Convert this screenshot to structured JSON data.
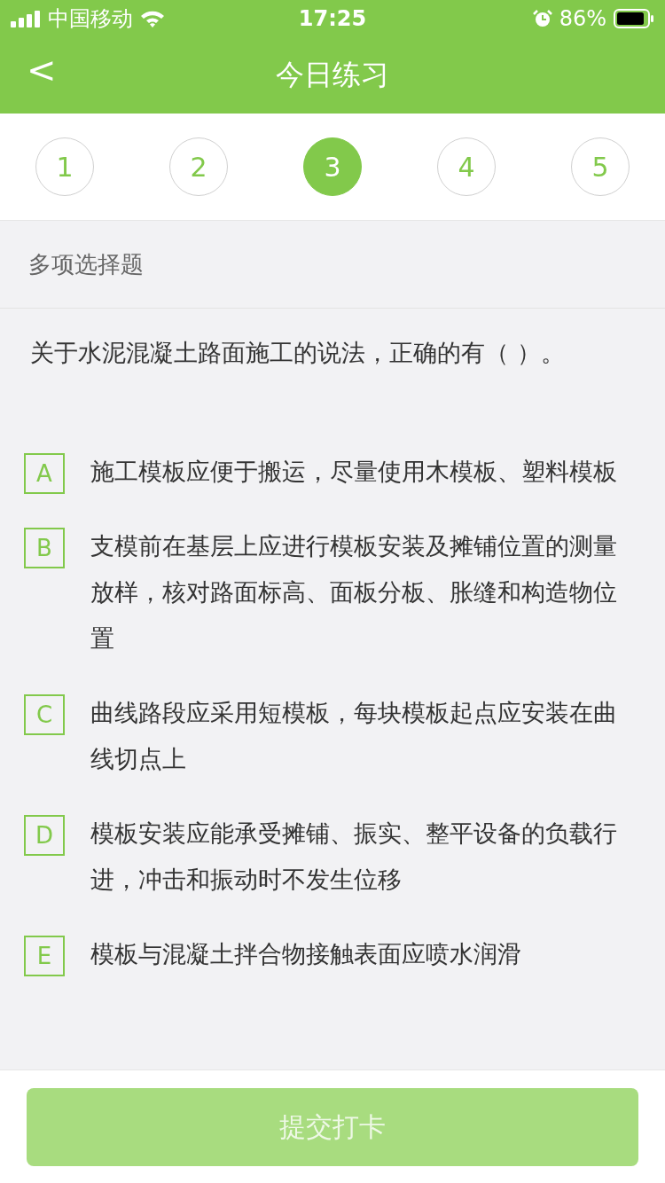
{
  "status_bar": {
    "carrier": "中国移动",
    "time": "17:25",
    "battery": "86%"
  },
  "nav": {
    "back": "<",
    "title": "今日练习"
  },
  "steps": [
    {
      "label": "1",
      "selected": false
    },
    {
      "label": "2",
      "selected": false
    },
    {
      "label": "3",
      "selected": true
    },
    {
      "label": "4",
      "selected": false
    },
    {
      "label": "5",
      "selected": false
    }
  ],
  "question_type": "多项选择题",
  "question": "关于水泥混凝土路面施工的说法，正确的有（    ）。",
  "options": [
    {
      "letter": "A",
      "text": "施工模板应便于搬运，尽量使用木模板、塑料模板",
      "selected": false
    },
    {
      "letter": "B",
      "text": "支模前在基层上应进行模板安装及摊铺位置的测量放样，核对路面标高、面板分板、胀缝和构造物位置",
      "selected": false
    },
    {
      "letter": "C",
      "text": "曲线路段应采用短模板，每块模板起点应安装在曲线切点上",
      "selected": false
    },
    {
      "letter": "D",
      "text": "模板安装应能承受摊铺、振实、整平设备的负载行进，冲击和振动时不发生位移",
      "selected": false
    },
    {
      "letter": "E",
      "text": "模板与混凝土拌合物接触表面应喷水润滑",
      "selected": false
    }
  ],
  "submit": {
    "label": "提交打卡",
    "disabled": true
  }
}
